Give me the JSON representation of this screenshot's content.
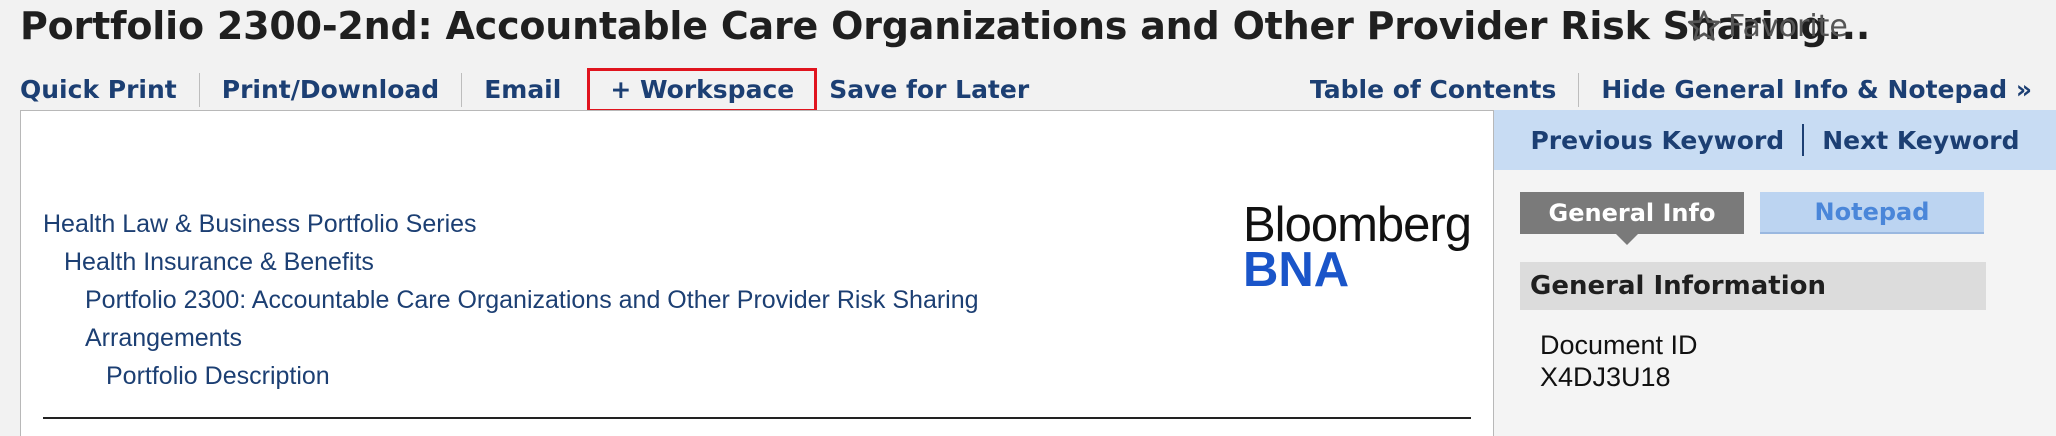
{
  "header": {
    "title": "Portfolio 2300-2nd: Accountable Care Organizations and Other Provider Risk Sharing...",
    "favorite_label": "Favorite",
    "favorite_icon": "star-outline-icon"
  },
  "toolbar": {
    "quick_print": "Quick Print",
    "print_download": "Print/Download",
    "email": "Email",
    "workspace": "+ Workspace",
    "save_for_later": "Save for Later",
    "table_of_contents": "Table of Contents",
    "hide_general_info": "Hide General Info & Notepad »",
    "highlight_color": "#e0141e"
  },
  "content": {
    "breadcrumbs": [
      "Health Law & Business Portfolio Series",
      "Health Insurance & Benefits",
      "Portfolio 2300: Accountable Care Organizations and Other Provider Risk Sharing",
      "Arrangements",
      "Portfolio Description"
    ],
    "logo": {
      "top": "Bloomberg",
      "bottom": "BNA",
      "bottom_color": "#1a55c9"
    }
  },
  "side_panel": {
    "previous_keyword": "Previous Keyword",
    "next_keyword": "Next Keyword",
    "tabs": {
      "general_info": "General Info",
      "notepad": "Notepad"
    },
    "section_title": "General Information",
    "document_id_label": "Document ID",
    "document_id_value": "X4DJ3U18"
  }
}
